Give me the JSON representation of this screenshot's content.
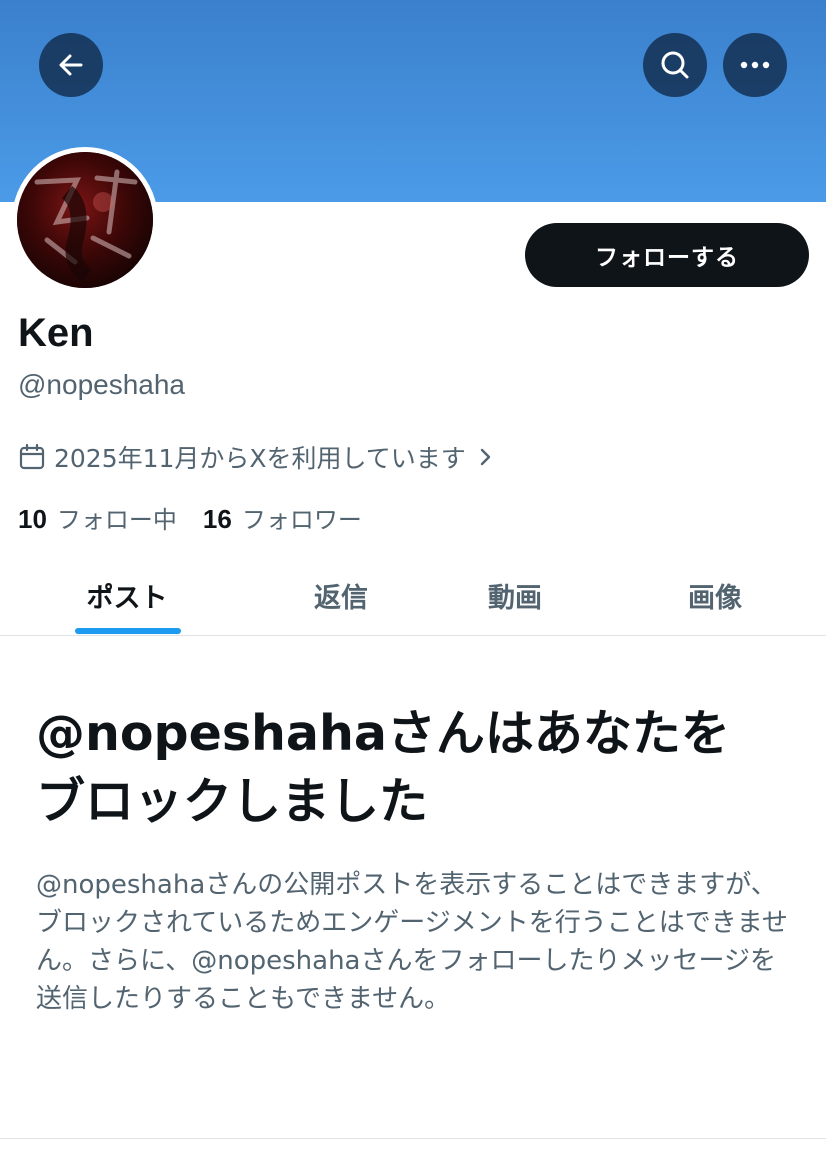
{
  "profile": {
    "display_name": "Ken",
    "handle": "@nopeshaha",
    "joined": "2025年11月からXを利用しています",
    "following_count": "10",
    "following_label": "フォロー中",
    "followers_count": "16",
    "followers_label": "フォロワー",
    "follow_button": "フォローする"
  },
  "header": {
    "back_icon": "arrow-left-icon",
    "search_icon": "search-icon",
    "more_icon": "more-horizontal-icon",
    "banner_color": "#4b9be8"
  },
  "tabs": [
    {
      "label": "ポスト",
      "active": true
    },
    {
      "label": "返信",
      "active": false
    },
    {
      "label": "動画",
      "active": false
    },
    {
      "label": "画像",
      "active": false
    }
  ],
  "blocked_notice": {
    "title": "@nopeshahaさんはあなたをブロックしました",
    "body": "@nopeshahaさんの公開ポストを表示することはできますが、ブロックされているためエンゲージメントを行うことはできません。さらに、@nopeshahaさんをフォローしたりメッセージを送信したりすることもできません。"
  },
  "colors": {
    "accent": "#1d9bf0",
    "text_primary": "#0f1419",
    "text_secondary": "#536471"
  }
}
